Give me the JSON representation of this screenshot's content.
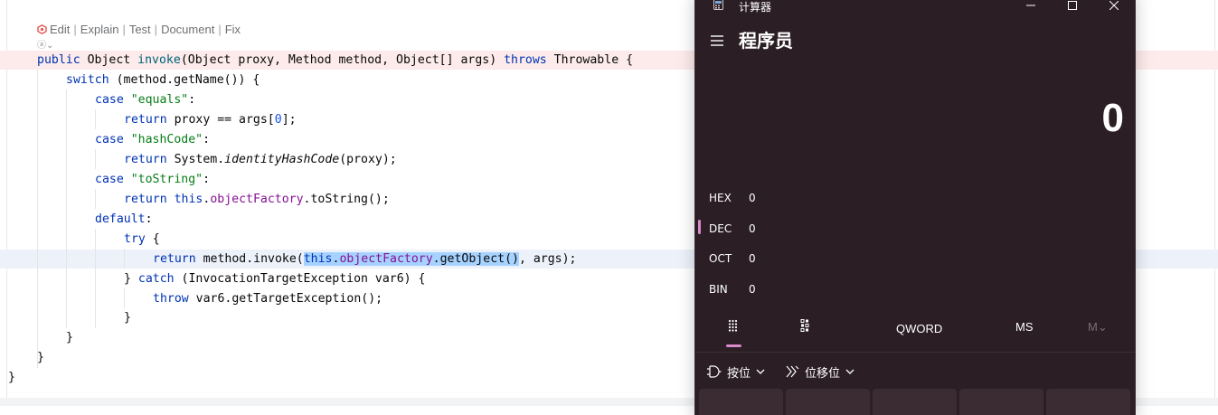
{
  "editor": {
    "hint": {
      "edit": "Edit",
      "explain": "Explain",
      "test": "Test",
      "document": "Document",
      "fix": "Fix",
      "separator": "|"
    },
    "hint2": "ⓐ⌄",
    "code": {
      "l1": {
        "kw1": "public",
        "t1": " Object ",
        "fn": "invoke",
        "t2": "(Object proxy, Method method, Object[] args) ",
        "kw2": "throws",
        "t3": " Throwable {"
      },
      "l2": {
        "kw": "switch",
        "t": " (method.getName()) {"
      },
      "l3": {
        "kw": "case",
        "sp": " ",
        "str": "\"equals\"",
        "t": ":"
      },
      "l4": {
        "kw": "return",
        "t1": " proxy == args[",
        "num": "0",
        "t2": "];"
      },
      "l5": {
        "kw": "case",
        "sp": " ",
        "str": "\"hashCode\"",
        "t": ":"
      },
      "l6": {
        "kw": "return",
        "t1": " System.",
        "ita": "identityHashCode",
        "t2": "(proxy);"
      },
      "l7": {
        "kw": "case",
        "sp": " ",
        "str": "\"toString\"",
        "t": ":"
      },
      "l8": {
        "kw1": "return",
        "sp": " ",
        "kw2": "this",
        "dot": ".",
        "fld": "objectFactory",
        "t": ".toString();"
      },
      "l9": {
        "kw": "default",
        "t": ":"
      },
      "l10": {
        "kw": "try",
        "t": " {"
      },
      "l11": {
        "kw1": "return",
        "t1": " method.invoke(",
        "kw2": "this",
        "dot": ".",
        "fld": "objectFactory",
        "t2": ".getObject()",
        "t3": ", args);"
      },
      "l12": {
        "t1": "} ",
        "kw": "catch",
        "t2": " (InvocationTargetException var6) {"
      },
      "l13": {
        "kw": "throw",
        "t": " var6.getTargetException();"
      },
      "l14": {
        "t": "}"
      },
      "l15": {
        "t": "}"
      },
      "l16": {
        "t": "}"
      },
      "l17": {
        "t": "}"
      }
    }
  },
  "calculator": {
    "window_title": "计算器",
    "mode": "程序员",
    "display": "0",
    "radix": [
      {
        "name": "HEX",
        "value": "0"
      },
      {
        "name": "DEC",
        "value": "0"
      },
      {
        "name": "OCT",
        "value": "0"
      },
      {
        "name": "BIN",
        "value": "0"
      }
    ],
    "selected_radix": "DEC",
    "tabs": {
      "keypad_icon": "full-keypad-icon",
      "bit_icon": "bit-toggle-keypad-icon",
      "word_size": "QWORD",
      "memory_store": "MS",
      "memory_list": "M⌄"
    },
    "ops": {
      "bitwise": "按位",
      "bitshift": "位移位"
    },
    "accent_color": "#d88ac9",
    "background_color": "#2b1e24"
  }
}
